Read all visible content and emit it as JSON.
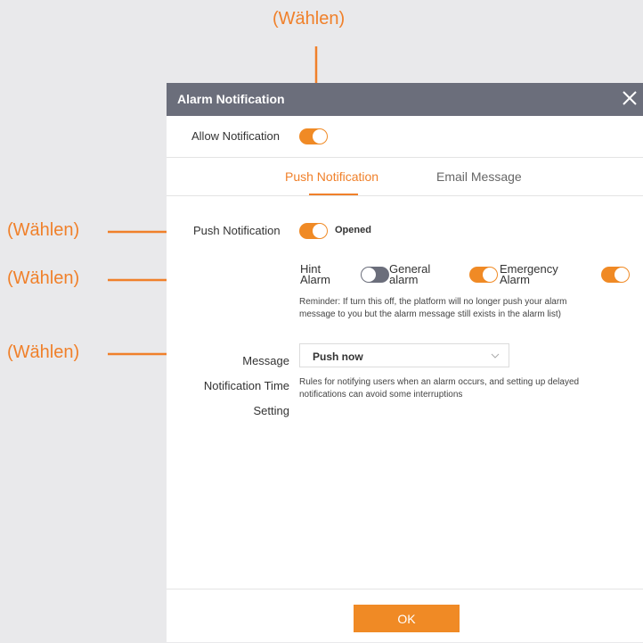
{
  "callouts": {
    "top": "(Wählen)",
    "push": "(Wählen)",
    "categories": "(Wählen)",
    "message": "(Wählen)"
  },
  "dialog": {
    "title": "Alarm Notification",
    "allow_label": "Allow Notification",
    "allow_on": true,
    "tabs": [
      {
        "label": "Push Notification",
        "active": true
      },
      {
        "label": "Email Message",
        "active": false
      }
    ],
    "push": {
      "label": "Push Notification",
      "status": "Opened",
      "on": true
    },
    "categories": [
      {
        "line1": "Hint",
        "line2": "Alarm",
        "on": false
      },
      {
        "line1": "General",
        "line2": "alarm",
        "on": true
      },
      {
        "line1": "Emergency",
        "line2": "Alarm",
        "on": true
      }
    ],
    "reminder": {
      "line1": "Reminder: If turn this off, the platform will no longer push your alarm",
      "line2": "message to you but the alarm message still exists in the alarm list)"
    },
    "message_setting": {
      "label_line1": "Message",
      "label_line2": "Notification Time",
      "label_line3": "Setting",
      "value": "Push now",
      "help_line1": "Rules for notifying users when an alarm occurs, and setting up delayed",
      "help_line2": "notifications can avoid some interruptions"
    },
    "ok_label": "OK"
  },
  "colors": {
    "accent": "#f08a25",
    "titlebar": "#6b6e7b",
    "callout": "#f0802a",
    "background": "#e9e9eb"
  },
  "icons": {
    "close": "close-icon",
    "dropdown": "chevron-down-icon"
  }
}
